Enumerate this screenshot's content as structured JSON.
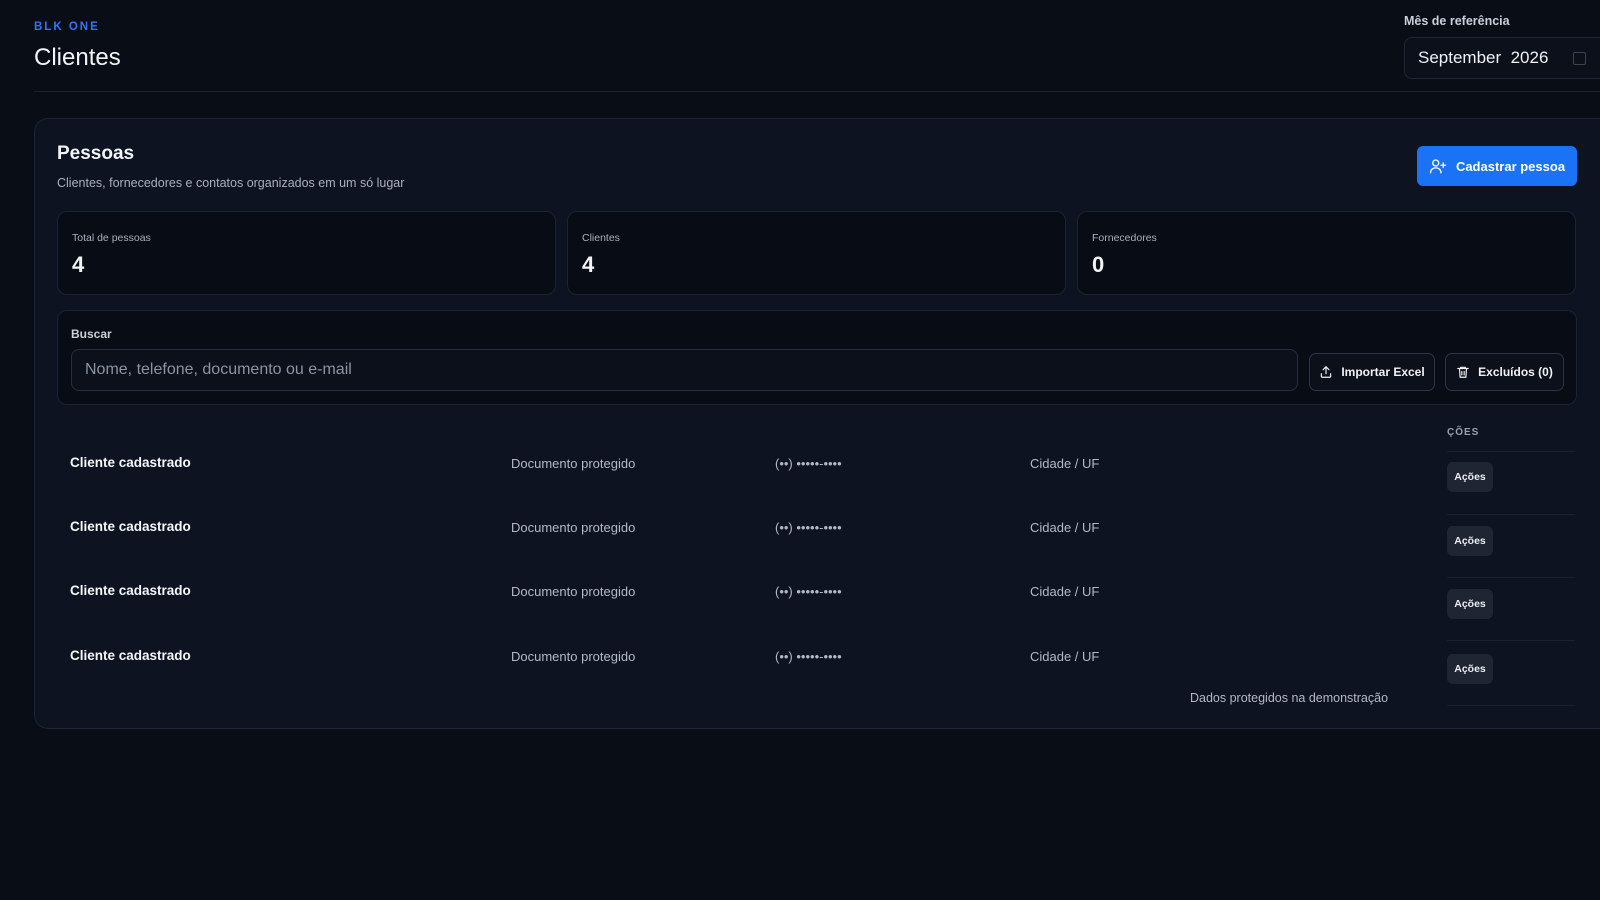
{
  "header": {
    "brand": "BLK ONE",
    "title": "Clientes",
    "month_label": "Mês de referência",
    "month_value": "September  2026"
  },
  "panel": {
    "title": "Pessoas",
    "subtitle": "Clientes, fornecedores e contatos organizados em um só lugar",
    "add_button": "Cadastrar pessoa"
  },
  "stats": [
    {
      "label": "Total de pessoas",
      "value": "4"
    },
    {
      "label": "Clientes",
      "value": "4"
    },
    {
      "label": "Fornecedores",
      "value": "0"
    }
  ],
  "search": {
    "label": "Buscar",
    "placeholder": "Nome, telefone, documento ou e-mail",
    "value": "",
    "import_button": "Importar Excel",
    "deleted_button": "Excluídos (0)"
  },
  "table": {
    "actions_header": "ÇÕES",
    "rows": [
      {
        "name": "Cliente cadastrado",
        "document": "Documento protegido",
        "phone": "(••) •••••-••••",
        "city": "Cidade / UF",
        "action": "Ações"
      },
      {
        "name": "Cliente cadastrado",
        "document": "Documento protegido",
        "phone": "(••) •••••-••••",
        "city": "Cidade / UF",
        "action": "Ações"
      },
      {
        "name": "Cliente cadastrado",
        "document": "Documento protegido",
        "phone": "(••) •••••-••••",
        "city": "Cidade / UF",
        "action": "Ações"
      },
      {
        "name": "Cliente cadastrado",
        "document": "Documento protegido",
        "phone": "(••) •••••-••••",
        "city": "Cidade / UF",
        "action": "Ações"
      }
    ],
    "footnote": "Dados protegidos na demonstração"
  },
  "icons": {
    "add_button": "user-plus-icon",
    "import_button": "upload-icon",
    "deleted_button": "trash-icon",
    "month_picker": "calendar-icon"
  },
  "colors": {
    "accent": "#1a73f5",
    "brand": "#2f74ff",
    "background": "#090d16",
    "panel": "#0d1321"
  }
}
